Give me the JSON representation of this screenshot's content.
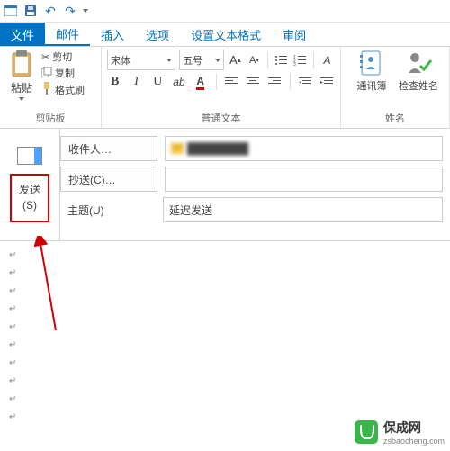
{
  "qat": {
    "undo": "↶",
    "redo": "↷"
  },
  "tabs": {
    "file": "文件",
    "mail": "邮件",
    "insert": "插入",
    "options": "选项",
    "format": "设置文本格式",
    "review": "审阅"
  },
  "ribbon": {
    "clipboard": {
      "paste": "粘贴",
      "cut": "剪切",
      "copy": "复制",
      "painter": "格式刷",
      "label": "剪贴板"
    },
    "basictext": {
      "font": "宋体",
      "size": "五号",
      "label": "普通文本"
    },
    "names": {
      "addressbook": "通讯簿",
      "checknames": "检查姓名",
      "label": "姓名"
    }
  },
  "message": {
    "send": "发送",
    "send_key": "(S)",
    "to_label": "收件人…",
    "cc_label": "抄送(C)…",
    "subject_label": "主题(U)",
    "to_value": "████████",
    "cc_value": "",
    "subject_value": "延迟发送"
  },
  "watermark": {
    "brand": "保成网",
    "url": "zsbaocheng.com"
  }
}
